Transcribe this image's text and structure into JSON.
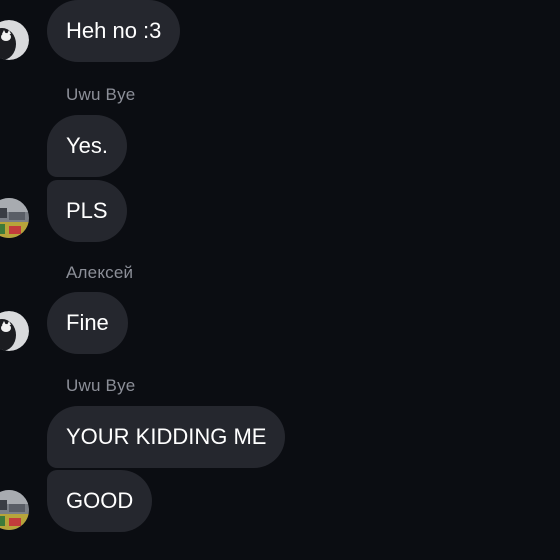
{
  "colors": {
    "background": "#0b0d12",
    "bubble": "#25272e",
    "text": "#ffffff",
    "sender_name": "#8c8f98"
  },
  "messages": [
    {
      "text": "Heh no :3"
    },
    {
      "sender": "Uwu Bye",
      "text": "Yes."
    },
    {
      "text": "PLS"
    },
    {
      "sender": "Алексей",
      "text": "Fine"
    },
    {
      "sender": "Uwu Bye",
      "text": "YOUR KIDDING ME"
    },
    {
      "text": "GOOD"
    }
  ],
  "icons": {
    "avatar_a": "cat-avatar-icon",
    "avatar_b": "photo-avatar-icon"
  }
}
